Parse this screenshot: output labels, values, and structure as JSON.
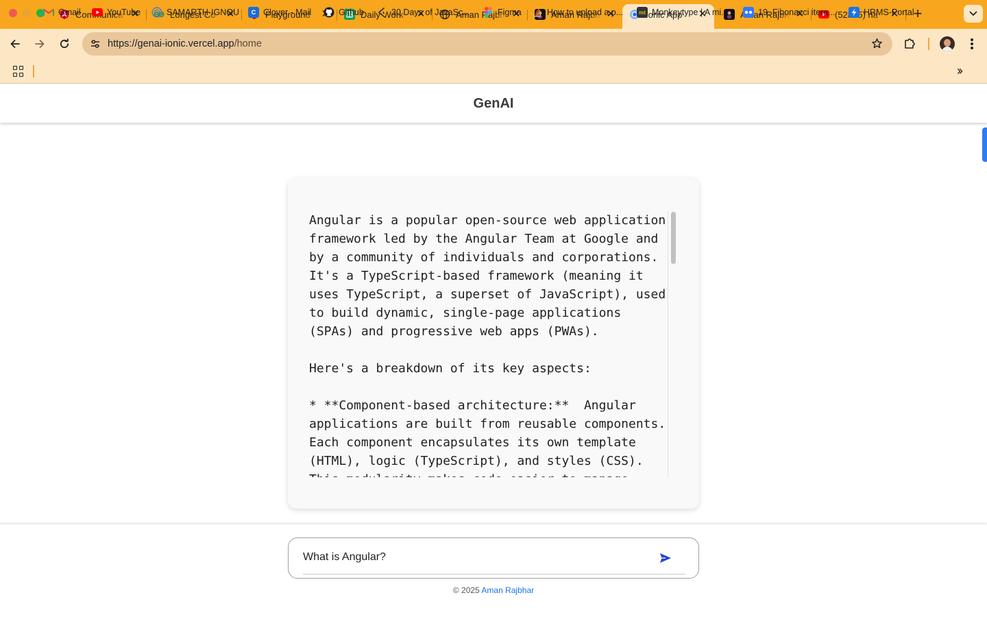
{
  "browser": {
    "tabs": [
      {
        "title": "Communica",
        "favicon": "angular-icon",
        "color": "#c3002f"
      },
      {
        "title": "Longest Co",
        "favicon": "geeksforgeeks-icon",
        "color": "#2f8d46"
      },
      {
        "title": "Playground",
        "favicon": "angular-icon",
        "color": "#c3002f"
      },
      {
        "title": "Daily Work",
        "favicon": "google-sheets-icon",
        "color": "#0f9d58"
      },
      {
        "title": "Aman Rajbh",
        "favicon": "globe-icon",
        "color": "#202124"
      },
      {
        "title": "Aman Rajbh",
        "favicon": "profile-icon",
        "color": "#111111"
      },
      {
        "title": "Ionic App",
        "favicon": "chrome-icon",
        "color": "#1a73e8",
        "active": true
      },
      {
        "title": "Aman Rajbh",
        "favicon": "profile-icon",
        "color": "#111111"
      },
      {
        "title": "(52855) na",
        "favicon": "youtube-icon",
        "color": "#ff0000"
      }
    ],
    "url": {
      "host": "https://genai-ionic.vercel.app",
      "path": "/home"
    },
    "bookmarks": [
      {
        "label": "Gmail",
        "icon": "gmail-icon",
        "color": "#ea4335"
      },
      {
        "label": "YouTube",
        "icon": "youtube-icon",
        "color": "#ff0000"
      },
      {
        "label": "SAMARTH-IGNOU",
        "icon": "samarth-icon",
        "color": "#3f7fbf"
      },
      {
        "label": "Clover - Mail",
        "icon": "clover-icon",
        "color": "#1e6bd6"
      },
      {
        "label": "Github",
        "icon": "github-icon",
        "color": "#202124"
      },
      {
        "label": "30 Days of JavaSc...",
        "icon": "js-icon",
        "color": "#333333"
      },
      {
        "label": "Figma",
        "icon": "figma-icon",
        "color": "#f24e1e"
      },
      {
        "label": "How to upload a p...",
        "icon": "stackoverflow-icon",
        "color": "#f48024"
      },
      {
        "label": "Monkeytype | A mi...",
        "icon": "monkeytype-icon",
        "color": "#323437"
      },
      {
        "label": "19. Fibonacci itera...",
        "icon": "coding-icon",
        "color": "#2f7bf4"
      },
      {
        "label": "HRMS-Portal",
        "icon": "hrms-icon",
        "color": "#1a73e8"
      }
    ]
  },
  "app": {
    "title": "GenAI",
    "answer": "Angular is a popular open-source web application framework led by the Angular Team at Google and by a community of individuals and corporations. It's a TypeScript-based framework (meaning it uses TypeScript, a superset of JavaScript), used to build dynamic, single-page applications (SPAs) and progressive web apps (PWAs).\n\nHere's a breakdown of its key aspects:\n\n* **Component-based architecture:**  Angular applications are built from reusable components. Each component encapsulates its own template (HTML), logic (TypeScript), and styles (CSS). This modularity makes code easier to manage",
    "prompt": {
      "value": "What is Angular?"
    },
    "footer": {
      "prefix": "© 2025",
      "author": "Aman Rajbhar"
    }
  },
  "colors": {
    "tabstrip": "#f8a61d",
    "toolbar": "#fde6c4",
    "accent": "#2f7bf4",
    "send": "#2344d8"
  }
}
